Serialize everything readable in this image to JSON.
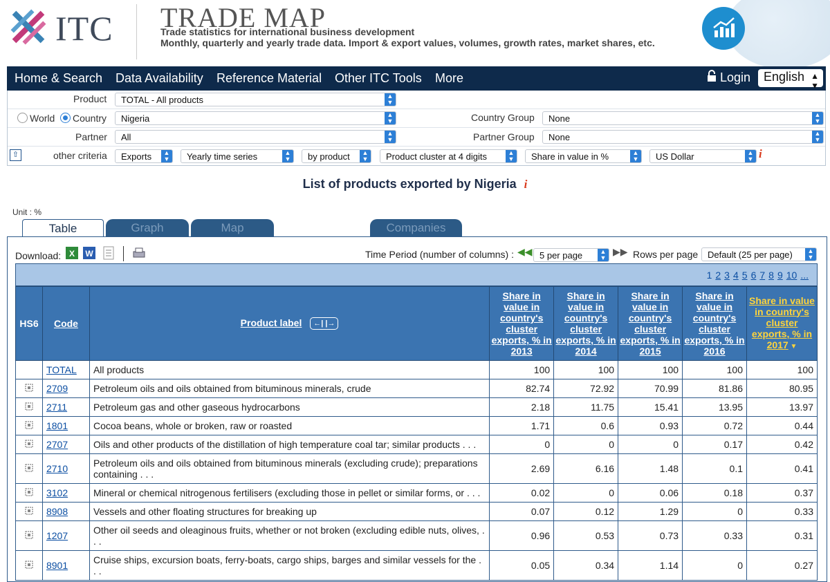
{
  "header": {
    "itc_logo_text": "ITC",
    "title": "TRADE MAP",
    "subtitle1": "Trade statistics for international business development",
    "subtitle2": "Monthly, quarterly and yearly trade data. Import & export values, volumes, growth rates, market shares, etc."
  },
  "nav": {
    "items": [
      "Home & Search",
      "Data Availability",
      "Reference Material",
      "Other ITC Tools",
      "More"
    ],
    "login": "Login",
    "language": "English"
  },
  "criteria": {
    "product_label": "Product",
    "product_value": "TOTAL - All products",
    "world_label": "World",
    "country_label": "Country",
    "country_value": "Nigeria",
    "country_group_label": "Country Group",
    "country_group_value": "None",
    "partner_label": "Partner",
    "partner_value": "All",
    "partner_group_label": "Partner Group",
    "partner_group_value": "None",
    "other_label": "other criteria",
    "flow": "Exports",
    "series": "Yearly time series",
    "by": "by product",
    "cluster": "Product cluster at 4 digits",
    "indicator": "Share in value in %",
    "currency": "US Dollar"
  },
  "page_title": "List of products exported by Nigeria",
  "unit": "Unit : %",
  "tabs": [
    "Table",
    "Graph",
    "Map",
    "Companies"
  ],
  "toolbar": {
    "download_label": "Download:",
    "time_period_label": "Time Period (number of columns) :",
    "time_period_value": "5 per page",
    "rows_label": "Rows per page",
    "rows_value": "Default (25 per page)"
  },
  "pagination": [
    "1",
    "2",
    "3",
    "4",
    "5",
    "6",
    "7",
    "8",
    "9",
    "10",
    "..."
  ],
  "table": {
    "col_hs6": "HS6",
    "col_code": "Code",
    "col_label": "Product label",
    "year_cols": [
      "Share in value in country's cluster exports, % in 2013",
      "Share in value in country's cluster exports, % in 2014",
      "Share in value in country's cluster exports, % in 2015",
      "Share in value in country's cluster exports, % in 2016",
      "Share in value in country's cluster exports, % in 2017"
    ],
    "rows": [
      {
        "code": "TOTAL",
        "label": "All products",
        "v": [
          "100",
          "100",
          "100",
          "100",
          "100"
        ],
        "hs": false,
        "tall": false
      },
      {
        "code": "2709",
        "label": "Petroleum oils and oils obtained from bituminous minerals, crude",
        "v": [
          "82.74",
          "72.92",
          "70.99",
          "81.86",
          "80.95"
        ],
        "hs": true,
        "tall": false
      },
      {
        "code": "2711",
        "label": "Petroleum gas and other gaseous hydrocarbons",
        "v": [
          "2.18",
          "11.75",
          "15.41",
          "13.95",
          "13.97"
        ],
        "hs": true,
        "tall": false
      },
      {
        "code": "1801",
        "label": "Cocoa beans, whole or broken, raw or roasted",
        "v": [
          "1.71",
          "0.6",
          "0.93",
          "0.72",
          "0.44"
        ],
        "hs": true,
        "tall": false
      },
      {
        "code": "2707",
        "label": "Oils and other products of the distillation of high temperature coal tar; similar products . . .",
        "v": [
          "0",
          "0",
          "0",
          "0.17",
          "0.42"
        ],
        "hs": true,
        "tall": false
      },
      {
        "code": "2710",
        "label": "Petroleum oils and oils obtained from bituminous minerals (excluding crude); preparations containing . . .",
        "v": [
          "2.69",
          "6.16",
          "1.48",
          "0.1",
          "0.41"
        ],
        "hs": true,
        "tall": true
      },
      {
        "code": "3102",
        "label": "Mineral or chemical nitrogenous fertilisers (excluding those in pellet or similar forms, or . . .",
        "v": [
          "0.02",
          "0",
          "0.06",
          "0.18",
          "0.37"
        ],
        "hs": true,
        "tall": false
      },
      {
        "code": "8908",
        "label": "Vessels and other floating structures for breaking up",
        "v": [
          "0.07",
          "0.12",
          "1.29",
          "0",
          "0.33"
        ],
        "hs": true,
        "tall": false
      },
      {
        "code": "1207",
        "label": "Other oil seeds and oleaginous fruits, whether or not broken (excluding edible nuts, olives, . . .",
        "v": [
          "0.96",
          "0.53",
          "0.73",
          "0.33",
          "0.31"
        ],
        "hs": true,
        "tall": true
      },
      {
        "code": "8901",
        "label": "Cruise ships, excursion boats, ferry-boats, cargo ships, barges and similar vessels for the . . .",
        "v": [
          "0.05",
          "0.34",
          "1.14",
          "0",
          "0.27"
        ],
        "hs": true,
        "tall": true
      }
    ]
  }
}
